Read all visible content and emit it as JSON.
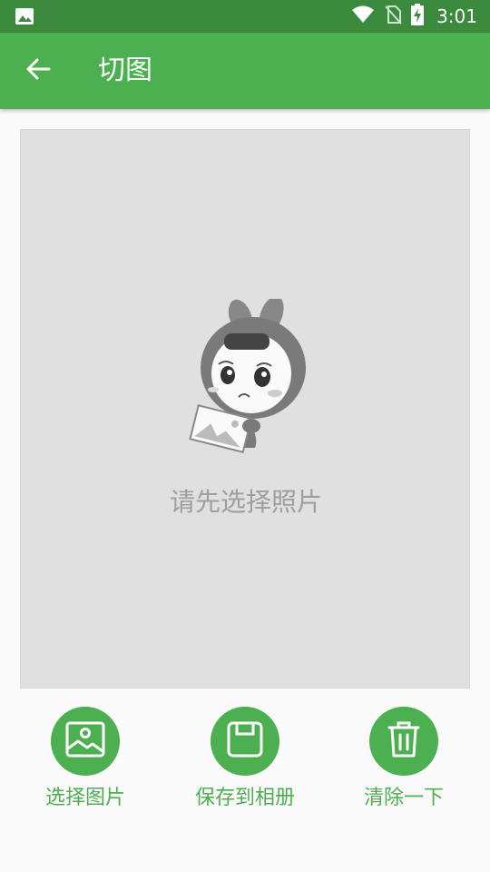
{
  "status_bar": {
    "time": "3:01",
    "icons": [
      "image-notification-icon",
      "wifi-icon",
      "no-sim-icon",
      "battery-charging-icon"
    ]
  },
  "toolbar": {
    "back_icon": "arrow-left-icon",
    "title": "切图"
  },
  "canvas": {
    "empty_text": "请先选择照片"
  },
  "actions": [
    {
      "label": "选择图片",
      "icon": "image-icon"
    },
    {
      "label": "保存到相册",
      "icon": "save-icon"
    },
    {
      "label": "清除一下",
      "icon": "trash-icon"
    }
  ],
  "colors": {
    "primary": "#4caf50",
    "primary_dark": "#3b8a3e",
    "canvas_bg": "#e0e0e0",
    "placeholder_text": "#9e9e9e"
  }
}
